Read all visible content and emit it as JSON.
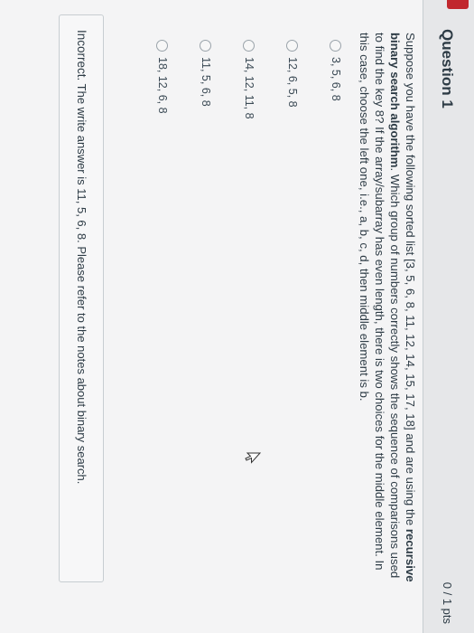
{
  "question": {
    "title": "Question 1",
    "points": "0 / 1 pts",
    "prompt_intro": "Suppose you have the following sorted list [3, 5, 6, 8, 11, 12, 14, 15, 17, 18] and are using the ",
    "prompt_bold": "recursive binary search algorithm",
    "prompt_rest": ". Which group of numbers correctly shows the sequence of comparisons used to find the key 8? If the array/subarray has even length, there is two choices for the middle element. In this case, choose the left one, i.e., a, b, c, d, then middle element is b."
  },
  "answers": [
    {
      "label": "3, 5, 6, 8",
      "selected": false
    },
    {
      "label": "12, 6, 5, 8",
      "selected": false
    },
    {
      "label": "14, 12, 11, 8",
      "selected": false
    },
    {
      "label": "11, 5, 6, 8",
      "selected": false
    },
    {
      "label": "18, 12, 6, 8",
      "selected": false
    }
  ],
  "feedback": {
    "status": "Incorrect.",
    "message": " The write answer is 11, 5, 6, 8.  Please refer to the notes about binary search."
  },
  "icons": {
    "flag": "red-flag-tab",
    "cursor": "mouse-pointer-icon"
  },
  "colors": {
    "text": "#2d3b45",
    "flag": "#c1272d",
    "header_bg": "#e6e7e9"
  }
}
